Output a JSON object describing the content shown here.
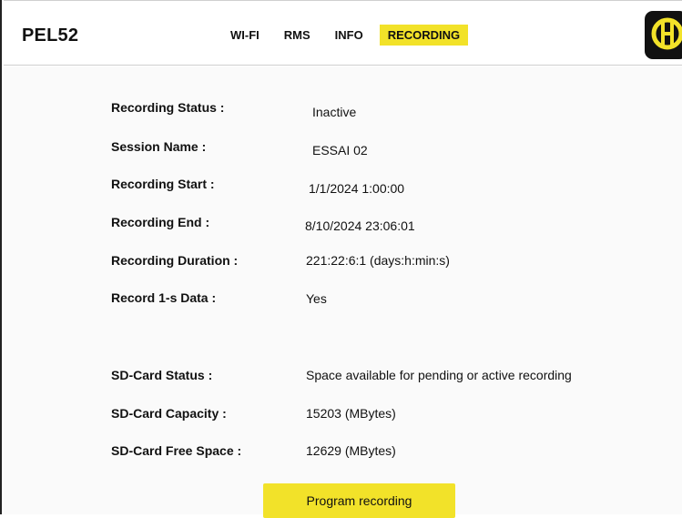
{
  "header": {
    "brand": "PEL52",
    "tabs": [
      {
        "label": "WI-FI",
        "active": false
      },
      {
        "label": "RMS",
        "active": false
      },
      {
        "label": "INFO",
        "active": false
      },
      {
        "label": "RECORDING",
        "active": true
      }
    ],
    "logo_icon": "ca-logo-icon"
  },
  "recording": {
    "rows": [
      {
        "label": "Recording Status :",
        "value": "Inactive"
      },
      {
        "label": "Session Name :",
        "value": "ESSAI 02"
      },
      {
        "label": "Recording Start :",
        "value": "1/1/2024 1:00:00"
      },
      {
        "label": "Recording End :",
        "value": "8/10/2024 23:06:01"
      },
      {
        "label": "Recording Duration :",
        "value": "221:22:6:1 (days:h:min:s)"
      },
      {
        "label": "Record 1-s Data :",
        "value": "Yes"
      }
    ]
  },
  "sdcard": {
    "rows": [
      {
        "label": "SD-Card Status :",
        "value": "Space available for pending or active recording"
      },
      {
        "label": "SD-Card Capacity :",
        "value": "15203 (MBytes)"
      },
      {
        "label": "SD-Card Free Space :",
        "value": "12629 (MBytes)"
      }
    ]
  },
  "actions": {
    "program_label": "Program recording"
  },
  "colors": {
    "accent": "#f2e229",
    "logo_bg": "#111111"
  }
}
